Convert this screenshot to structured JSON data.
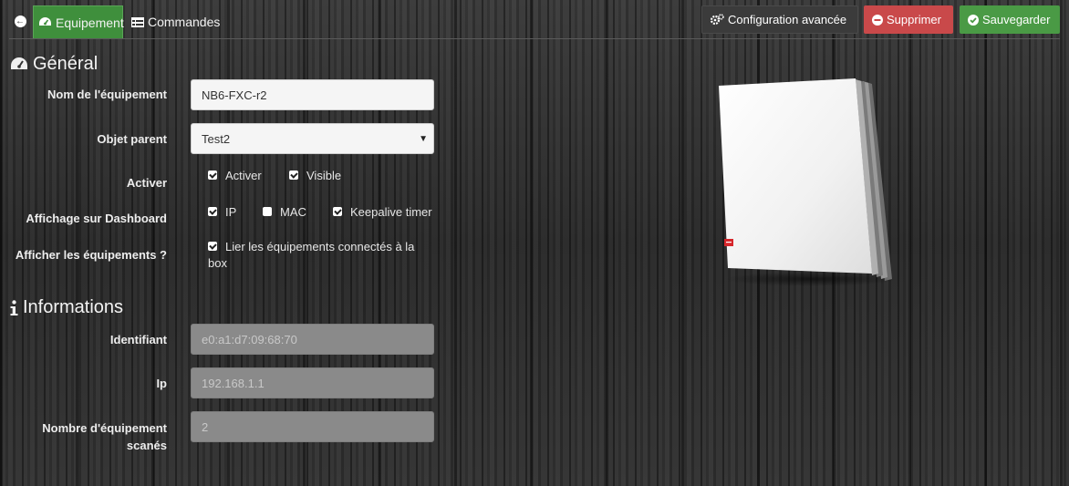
{
  "tabs": {
    "equipement": "Equipement",
    "commandes": "Commandes"
  },
  "actions": {
    "config": "Configuration avancée",
    "delete": "Supprimer",
    "save": "Sauvegarder"
  },
  "colors": {
    "active_tab": "#3f8f3c",
    "delete": "#c9494a",
    "save": "#4a9a45"
  },
  "general": {
    "title": "Général",
    "name_label": "Nom de l'équipement",
    "name_value": "NB6-FXC-r2",
    "parent_label": "Objet parent",
    "parent_value": "Test2",
    "activate_label": "Activer",
    "activate_options": [
      {
        "label": "Activer",
        "checked": true
      },
      {
        "label": "Visible",
        "checked": true
      }
    ],
    "dashboard_label": "Affichage sur Dashboard",
    "dashboard_options": [
      {
        "label": "IP",
        "checked": true
      },
      {
        "label": "MAC",
        "checked": false
      },
      {
        "label": "Keepalive timer",
        "checked": true
      }
    ],
    "show_devices_label": "Afficher les équipements ?",
    "show_devices_option": {
      "label": "Lier les équipements connectés à la box",
      "checked": true
    }
  },
  "informations": {
    "title": "Informations",
    "id_label": "Identifiant",
    "id_value": "e0:a1:d7:09:68:70",
    "ip_label": "Ip",
    "ip_value": "192.168.1.1",
    "scan_label": "Nombre d'équipement scanés",
    "scan_value": "2"
  },
  "icons": [
    "back-icon",
    "dashboard-icon",
    "list-icon",
    "cogs-icon",
    "minus-circle-icon",
    "check-circle-icon",
    "info-icon",
    "router-image"
  ]
}
